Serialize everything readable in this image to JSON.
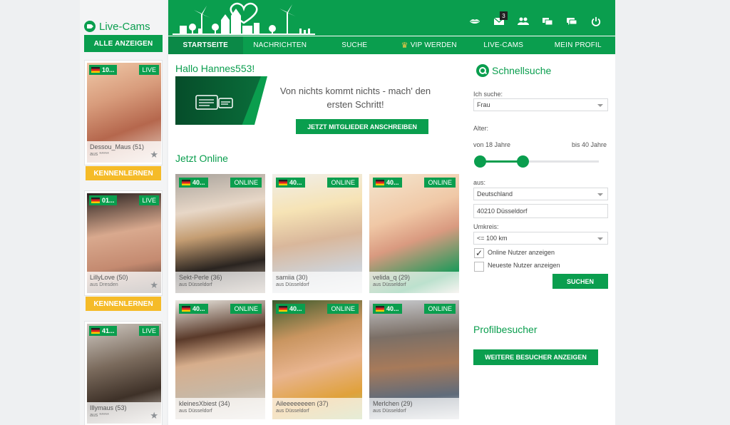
{
  "livecams": {
    "title": "Live-Cams",
    "all_button": "ALLE ANZEIGEN",
    "meet_button": "KENNENLERNEN",
    "cards": [
      {
        "flag_text": "10...",
        "badge": "LIVE",
        "name": "Dessou_Maus (51)",
        "city": "aus *****"
      },
      {
        "flag_text": "01...",
        "badge": "LIVE",
        "name": "LillyLove (50)",
        "city": "aus Dresden"
      },
      {
        "flag_text": "41...",
        "badge": "LIVE",
        "name": "Illymaus (53)",
        "city": "aus *****"
      }
    ]
  },
  "header": {
    "mail_badge": "3",
    "icons": [
      "lips-icon",
      "mail-icon",
      "users-icon",
      "gallery-icon",
      "chat-icon",
      "power-icon"
    ]
  },
  "nav": {
    "items": [
      "STARTSEITE",
      "NACHRICHTEN",
      "SUCHE",
      "VIP WERDEN",
      "LIVE-CAMS",
      "MEIN PROFIL"
    ]
  },
  "main": {
    "greeting": "Hallo Hannes553!",
    "promo_text": "Von nichts kommt nichts - mach' den ersten Schritt!",
    "promo_button": "JETZT MITGLIEDER ANSCHREIBEN",
    "online_title": "Jetzt Online",
    "users": [
      {
        "flag_text": "40...",
        "badge": "ONLINE",
        "name": "Sekt-Perle (36)",
        "city": "aus Düsseldorf"
      },
      {
        "flag_text": "40...",
        "badge": "ONLINE",
        "name": "samiia (30)",
        "city": "aus Düsseldorf"
      },
      {
        "flag_text": "40...",
        "badge": "ONLINE",
        "name": "velida_q (29)",
        "city": "aus Düsseldorf"
      },
      {
        "flag_text": "40...",
        "badge": "ONLINE",
        "name": "kleinesXbiest (34)",
        "city": "aus Düsseldorf"
      },
      {
        "flag_text": "40...",
        "badge": "ONLINE",
        "name": "Aileeeeeeeen (37)",
        "city": "aus Düsseldorf"
      },
      {
        "flag_text": "40...",
        "badge": "ONLINE",
        "name": "Merlchen (29)",
        "city": "aus Düsseldorf"
      }
    ]
  },
  "search": {
    "title": "Schnellsuche",
    "ich_suche_label": "Ich suche:",
    "ich_suche_value": "Frau",
    "alter_label": "Alter:",
    "age_from": "von 18 Jahre",
    "age_to": "bis 40 Jahre",
    "aus_label": "aus:",
    "country": "Deutschland",
    "location": "40210 Düsseldorf",
    "umkreis_label": "Umkreis:",
    "umkreis_value": "<= 100 km",
    "online_checkbox": "Online Nutzer anzeigen",
    "online_checked": "✓",
    "newest_checkbox": "Neueste Nutzer anzeigen",
    "search_button": "SUCHEN"
  },
  "visitors": {
    "title": "Profilbesucher",
    "button": "WEITERE BESUCHER ANZEIGEN"
  },
  "colors": {
    "brand_green": "#0a9e4e",
    "accent_yellow": "#f5bb28"
  }
}
